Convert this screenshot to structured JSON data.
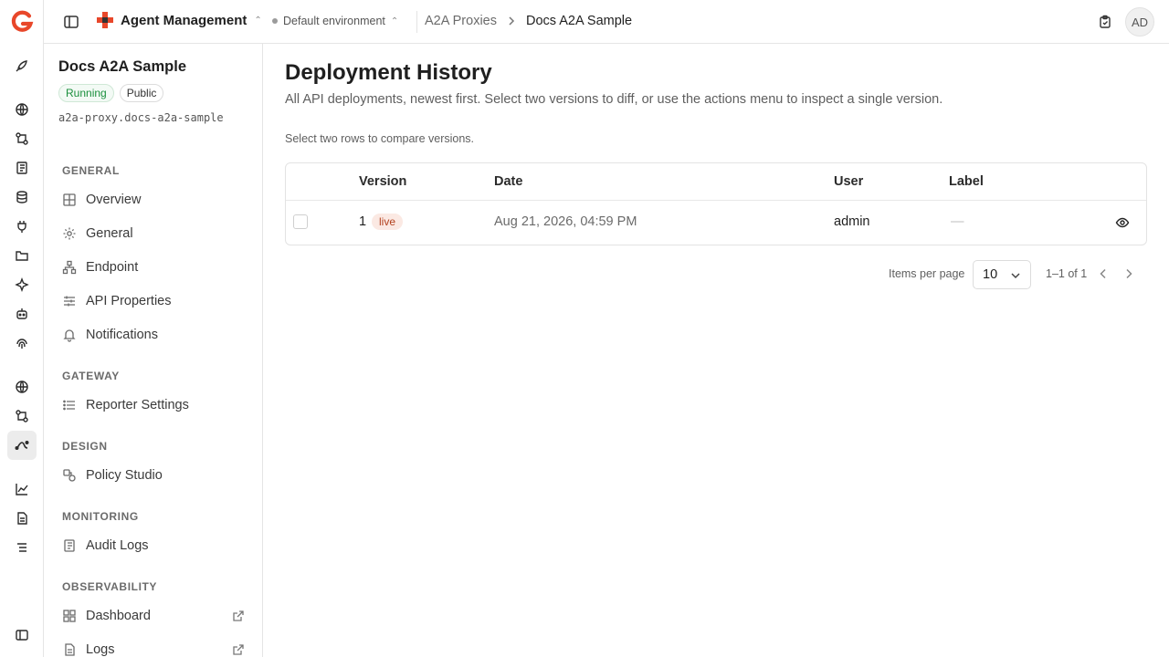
{
  "topbar": {
    "app_name": "Agent Management",
    "environment": "Default environment",
    "breadcrumbs": [
      "A2A Proxies",
      "Docs A2A Sample"
    ],
    "avatar_initials": "AD"
  },
  "api": {
    "name": "Docs A2A Sample",
    "status": "Running",
    "visibility": "Public",
    "path": "a2a-proxy.docs-a2a-sample"
  },
  "nav": {
    "general": {
      "title": "GENERAL",
      "items": [
        "Overview",
        "General",
        "Endpoint",
        "API Properties",
        "Notifications"
      ]
    },
    "gateway": {
      "title": "GATEWAY",
      "items": [
        "Reporter Settings"
      ]
    },
    "design": {
      "title": "DESIGN",
      "items": [
        "Policy Studio"
      ]
    },
    "monitoring": {
      "title": "MONITORING",
      "items": [
        "Audit Logs"
      ]
    },
    "observability": {
      "title": "OBSERVABILITY",
      "items": [
        "Dashboard",
        "Logs"
      ]
    }
  },
  "page": {
    "title": "Deployment History",
    "subtitle": "All API deployments, newest first. Select two versions to diff, or use the actions menu to inspect a single version.",
    "hint": "Select two rows to compare versions."
  },
  "table": {
    "columns": [
      "Version",
      "Date",
      "User",
      "Label"
    ],
    "rows": [
      {
        "version": "1",
        "tag": "live",
        "date": "Aug 21, 2026, 04:59 PM",
        "user": "admin",
        "label": "—"
      }
    ]
  },
  "pagination": {
    "items_per_page_label": "Items per page",
    "items_per_page": "10",
    "range": "1–1 of 1"
  },
  "colors": {
    "brand": "#e8472a",
    "running": "#1a8f3c",
    "live_text": "#b3421f",
    "live_bg": "#fbe9e3"
  }
}
